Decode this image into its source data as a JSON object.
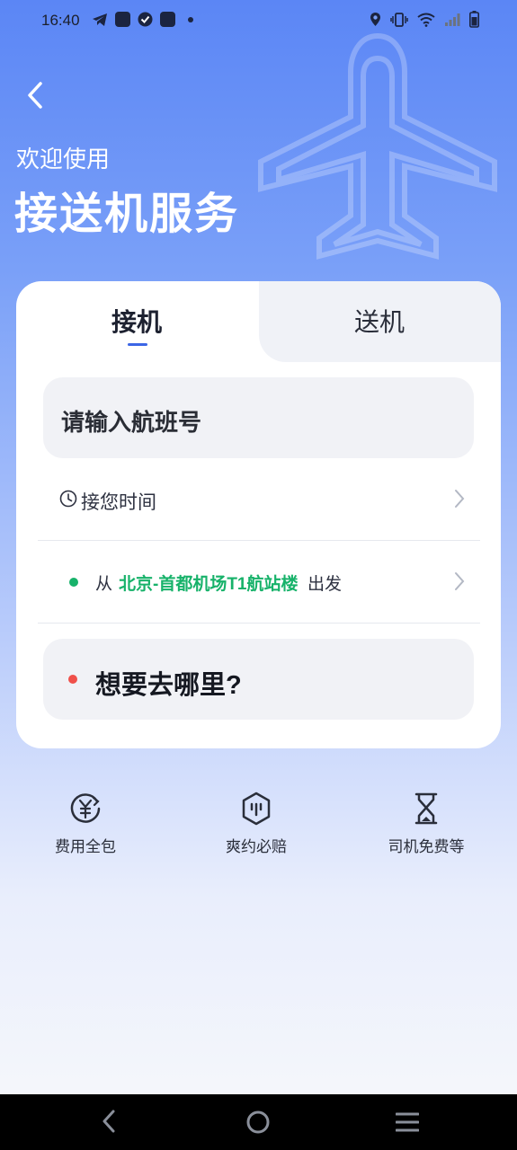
{
  "status_bar": {
    "time": "16:40",
    "left_icons": [
      "telegram-icon",
      "mail-icon",
      "check-icon",
      "vivo-icon",
      "dot-icon"
    ],
    "right_icons": [
      "location-icon",
      "vibrate-icon",
      "wifi-icon",
      "signal-icon",
      "battery-icon"
    ]
  },
  "header": {
    "welcome": "欢迎使用",
    "title": "接送机服务"
  },
  "tabs": [
    {
      "label": "接机",
      "selected": true
    },
    {
      "label": "送机",
      "selected": false
    }
  ],
  "form": {
    "flight_placeholder": "请输入航班号",
    "pickup_time_label": "接您时间",
    "from_prefix": "从",
    "from_place": "北京-首都机场T1航站楼",
    "from_suffix": "出发",
    "destination_placeholder": "想要去哪里?"
  },
  "features": [
    {
      "label": "费用全包",
      "icon": "yuan-icon"
    },
    {
      "label": "爽约必赔",
      "icon": "shield-icon"
    },
    {
      "label": "司机免费等",
      "icon": "hourglass-icon"
    }
  ],
  "colors": {
    "accent": "#3c66e6",
    "green": "#17b26a",
    "red": "#f0504a"
  }
}
